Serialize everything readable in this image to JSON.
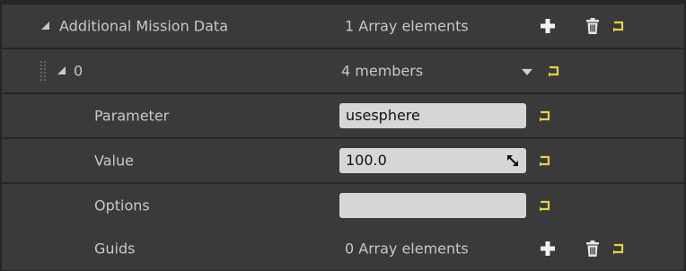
{
  "rows": {
    "root": {
      "label": "Additional Mission Data",
      "value": "1 Array elements"
    },
    "element0": {
      "label": "0",
      "value": "4 members"
    },
    "parameter": {
      "label": "Parameter",
      "value": "usesphere"
    },
    "value": {
      "label": "Value",
      "value": "100.0"
    },
    "options": {
      "label": "Options",
      "value": ""
    },
    "guids": {
      "label": "Guids",
      "value": "0 Array elements"
    }
  },
  "icons": {
    "expand": "triangle-expanded-icon",
    "add": "plus-icon",
    "delete": "trash-icon",
    "reset": "reset-to-default-icon",
    "combo": "chevron-down-icon",
    "grip": "drag-handle-icon",
    "resize": "resize-icon"
  },
  "colors": {
    "panel_bg": "#262626",
    "row_bg": "#3a3a3a",
    "text": "#c8c8c8",
    "input_bg": "#d6d6d6",
    "reset_yellow": "#e5d34a"
  }
}
